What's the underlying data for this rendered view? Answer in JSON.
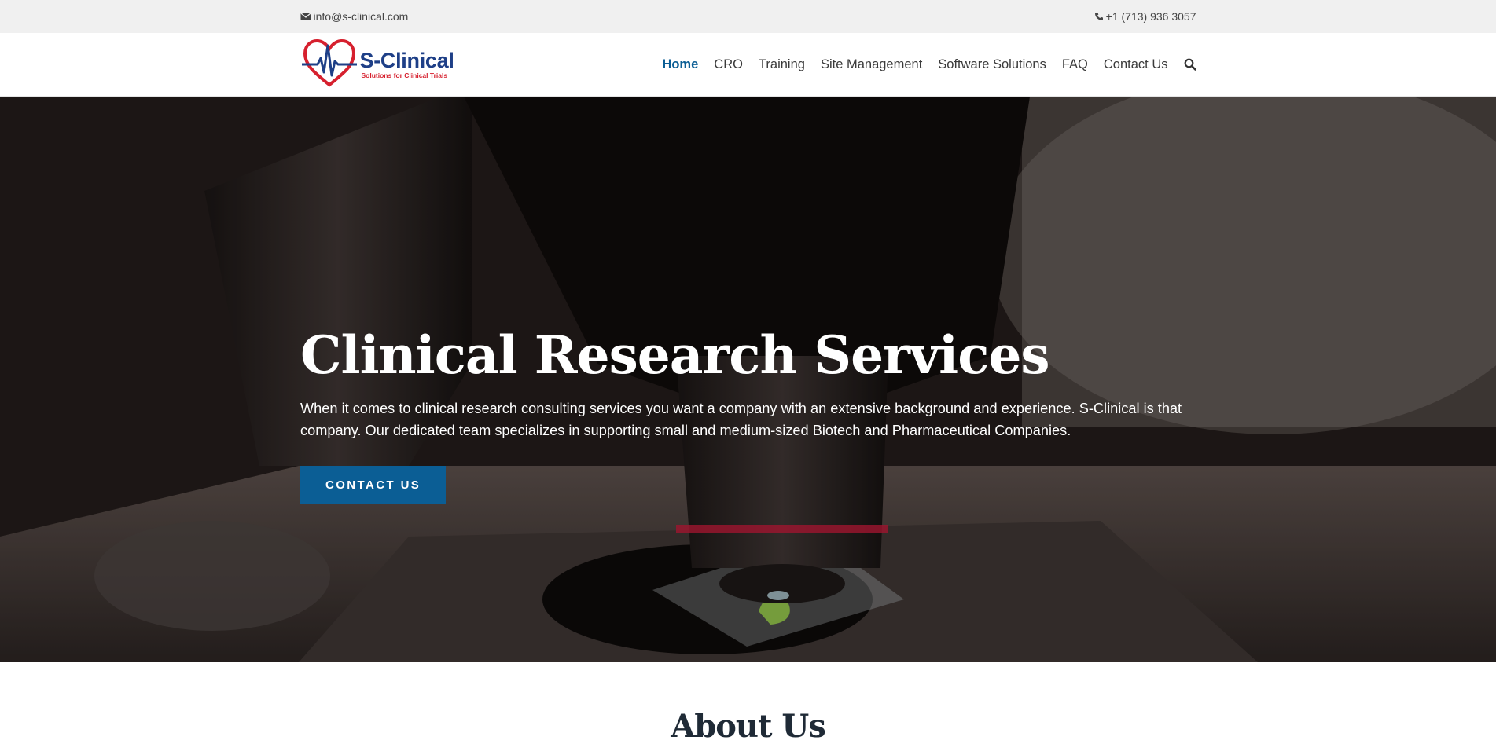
{
  "topbar": {
    "email": "info@s-clinical.com",
    "phone": "+1 (713) 936 3057"
  },
  "logo": {
    "title": "S-Clinical",
    "subtitle": "Solutions for Clinical Trials"
  },
  "nav": {
    "items": [
      {
        "label": "Home",
        "active": true
      },
      {
        "label": "CRO"
      },
      {
        "label": "Training"
      },
      {
        "label": "Site Management"
      },
      {
        "label": "Software Solutions"
      },
      {
        "label": "FAQ"
      },
      {
        "label": "Contact Us"
      }
    ],
    "search_icon": "search-icon"
  },
  "hero": {
    "title": "Clinical Research Services",
    "text": "When it comes to clinical research consulting services you want a company with an extensive background and experience. S-Clinical is that company. Our dedicated team specializes in supporting small and medium-sized Biotech and Pharmaceutical Companies.",
    "button": "CONTACT US"
  },
  "about": {
    "title": "About Us"
  },
  "colors": {
    "accent": "#0b5e95",
    "topbar_bg": "#f0f0f0",
    "logo_blue": "#1e3f87",
    "logo_red": "#d6202e"
  }
}
